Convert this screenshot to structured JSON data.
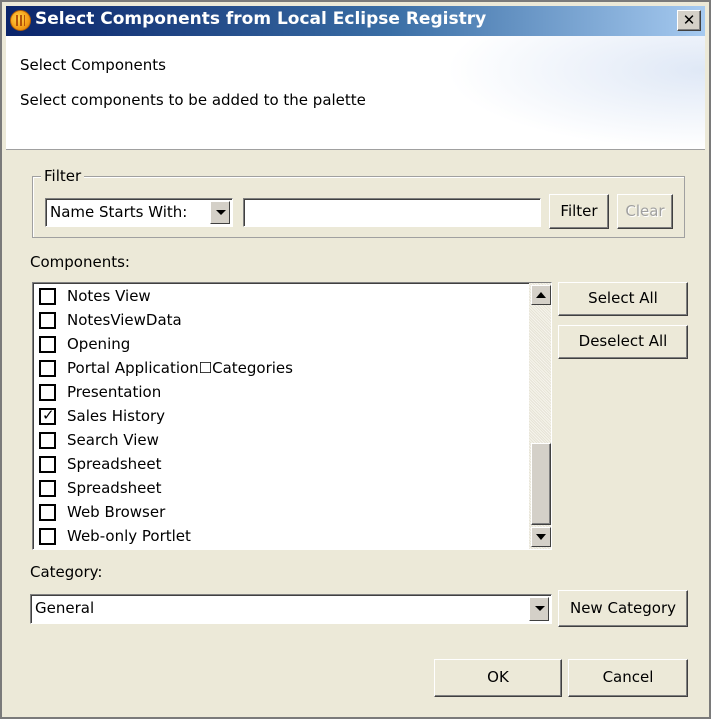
{
  "window": {
    "title": "Select Components from Local Eclipse Registry",
    "close_glyph": "✕"
  },
  "header": {
    "title": "Select Components",
    "description": "Select components to be added to the palette"
  },
  "filter": {
    "legend": "Filter",
    "mode_selected": "Name Starts With:",
    "text_value": "",
    "filter_button": "Filter",
    "clear_button": "Clear",
    "clear_enabled": false
  },
  "components": {
    "label": "Components:",
    "items": [
      {
        "label": "Notes View",
        "checked": false
      },
      {
        "label": "NotesViewData",
        "checked": false
      },
      {
        "label": "Opening",
        "checked": false
      },
      {
        "label": "Portal Application☐Categories",
        "checked": false
      },
      {
        "label": "Presentation",
        "checked": false
      },
      {
        "label": "Sales History",
        "checked": true
      },
      {
        "label": "Search View",
        "checked": false
      },
      {
        "label": "Spreadsheet",
        "checked": false
      },
      {
        "label": "Spreadsheet",
        "checked": false
      },
      {
        "label": "Web Browser",
        "checked": false
      },
      {
        "label": "Web-only Portlet",
        "checked": false
      }
    ],
    "select_all_button": "Select All",
    "deselect_all_button": "Deselect All"
  },
  "category": {
    "label": "Category:",
    "selected": "General",
    "new_category_button": "New Category"
  },
  "footer": {
    "ok_button": "OK",
    "cancel_button": "Cancel"
  },
  "colors": {
    "titlebar_start": "#0a246a",
    "titlebar_end": "#a6caf0",
    "dialog_bg": "#ece9d8"
  }
}
